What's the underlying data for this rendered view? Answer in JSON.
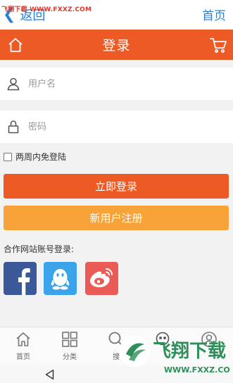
{
  "watermark_top": "飞翔下载 WWW.FXXZ.COM",
  "topbar": {
    "back_label": "返回",
    "home_link": "首页"
  },
  "header": {
    "title": "登录",
    "icons": [
      "home-icon",
      "cart-icon"
    ]
  },
  "form": {
    "username_placeholder": "用户名",
    "password_placeholder": "密码",
    "remember_label": "两周内免登陆"
  },
  "buttons": {
    "login": "立即登录",
    "register": "新用户注册"
  },
  "partner": {
    "label": "合作网站账号登录:",
    "providers": [
      "facebook",
      "qq",
      "weibo"
    ]
  },
  "tabs": [
    {
      "label": "首页",
      "icon": "home-icon"
    },
    {
      "label": "分类",
      "icon": "grid-icon"
    },
    {
      "label": "搜",
      "icon": "search-icon"
    },
    {
      "label": "",
      "icon": "chat-icon"
    },
    {
      "label": "",
      "icon": "user-icon"
    }
  ],
  "watermark_br": {
    "text": "飞翔下载",
    "url": "WWW.FXXZ.COM"
  },
  "colors": {
    "accent": "#ee5a26",
    "secondary": "#f7a33a",
    "link": "#2a7fd6"
  }
}
